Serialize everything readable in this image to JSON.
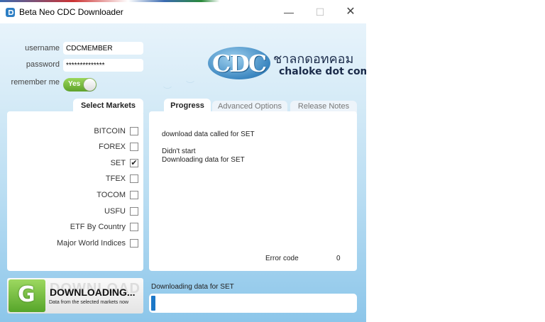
{
  "window": {
    "title": "Beta Neo CDC Downloader",
    "minimize_glyph": "—",
    "maximize_glyph": "☐",
    "close_glyph": "✕"
  },
  "login": {
    "username_label": "username",
    "username_value": "CDCMEMBER",
    "password_label": "password",
    "password_value": "**************",
    "remember_label": "remember me",
    "remember_toggle": "Yes",
    "remember_on": true
  },
  "logo": {
    "mark": "CDC",
    "thai_text": "ชาลกดอทคอม",
    "sub_text": "chaloke dot com"
  },
  "tabs": {
    "markets": "Select Markets",
    "progress": "Progress",
    "advanced": "Advanced Options",
    "release": "Release Notes"
  },
  "markets": [
    {
      "name": "BITCOIN",
      "checked": false
    },
    {
      "name": "FOREX",
      "checked": false
    },
    {
      "name": "SET",
      "checked": true
    },
    {
      "name": "TFEX",
      "checked": false
    },
    {
      "name": "TOCOM",
      "checked": false
    },
    {
      "name": "USFU",
      "checked": false
    },
    {
      "name": "ETF By Country",
      "checked": false
    },
    {
      "name": "Major World Indices",
      "checked": false
    }
  ],
  "progress": {
    "log_lines": [
      "download data called for SET",
      "Didn't start",
      "Downloading data for SET"
    ],
    "error_label": "Error code",
    "error_value": "0"
  },
  "download_button": {
    "icon_letter": "G",
    "ghost_text": "DOWNLOAD",
    "title": "DOWNLOADING...",
    "subtitle": "Data from the selected markets now"
  },
  "status": {
    "text": "Downloading data for SET",
    "progress_fraction": 0.02
  },
  "colors": {
    "accent_blue": "#1c78c8",
    "toggle_green": "#5ea22a",
    "background_sky": "#b7dcf2"
  },
  "icons": {
    "app": "cdc-app-icon",
    "check": "✔"
  }
}
